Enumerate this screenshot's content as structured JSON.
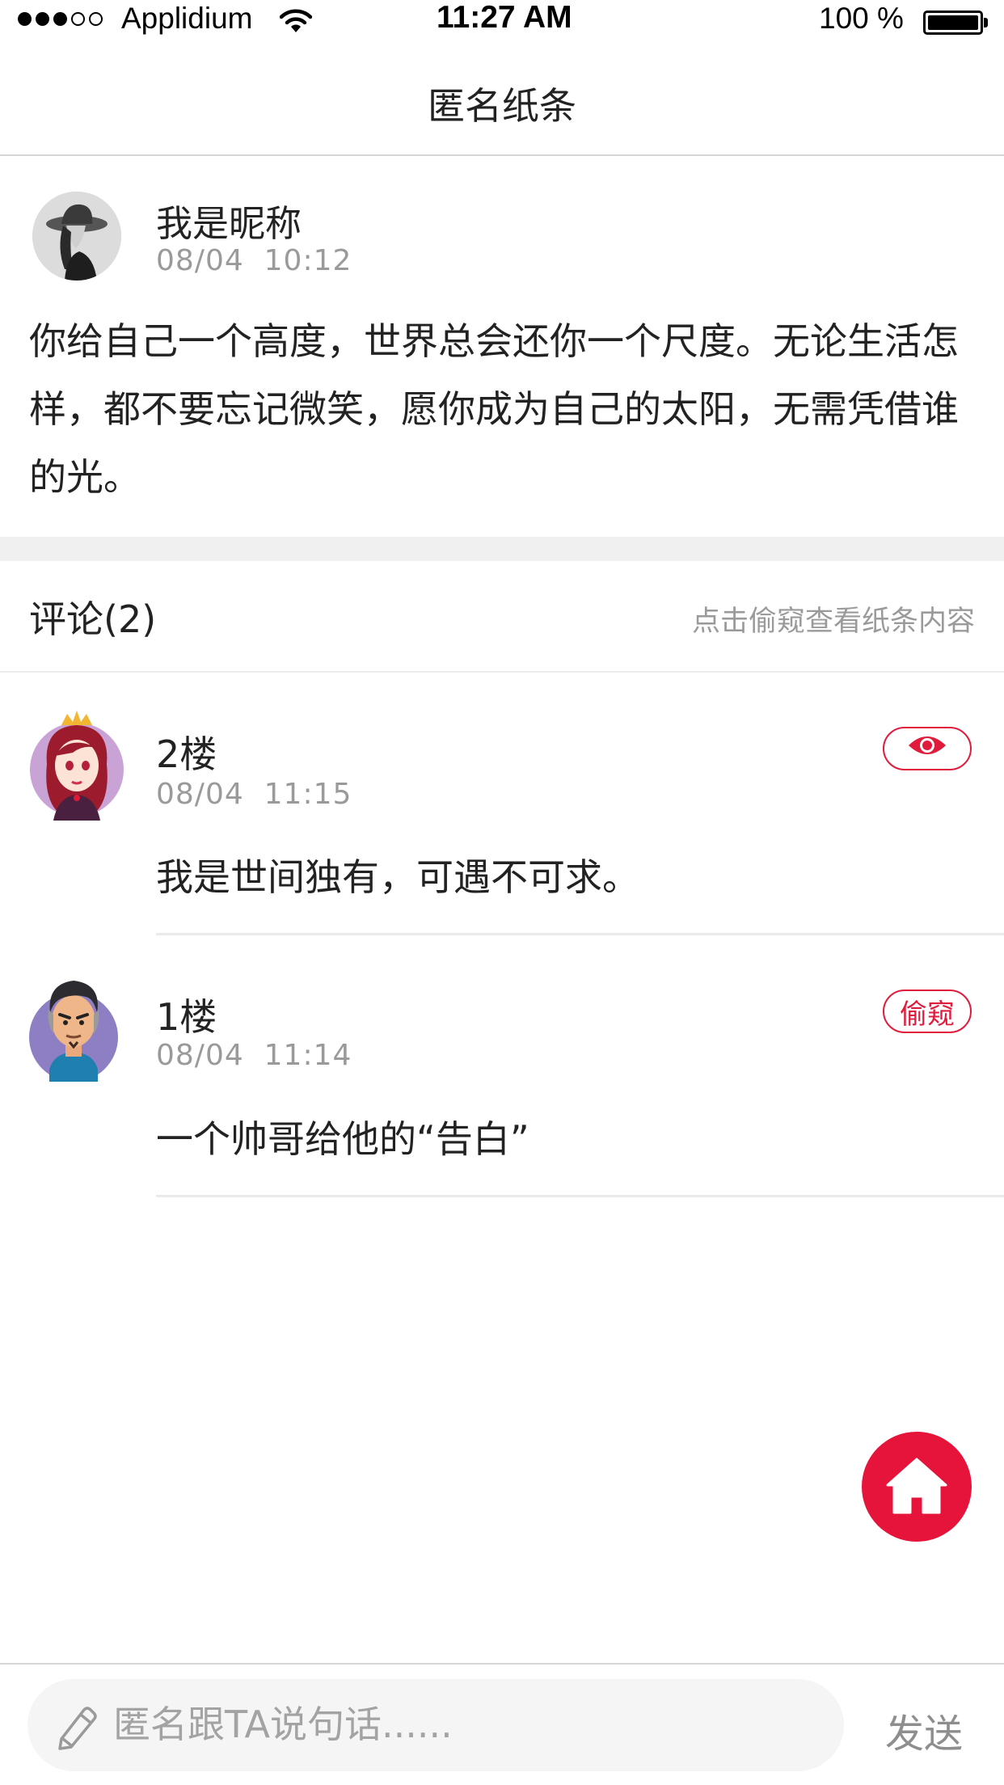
{
  "status_bar": {
    "carrier": "Applidium",
    "time": "11:27 AM",
    "battery": "100 %",
    "signal_bars_filled": 3,
    "signal_bars_total": 5
  },
  "nav": {
    "title": "匿名纸条"
  },
  "post": {
    "nickname": "我是昵称",
    "time": "08/04  10:12",
    "content": "你给自己一个高度，世界总会还你一个尺度。无论生活怎样，都不要忘记微笑，愿你成为自己的太阳，无需凭借谁的光。"
  },
  "comments_header": {
    "title": "评论(2)",
    "hint": "点击偷窥查看纸条内容"
  },
  "comments": [
    {
      "floor": "2楼",
      "time": "08/04  11:15",
      "content": "我是世间独有，可遇不可求。",
      "action_icon": "eye-icon"
    },
    {
      "floor": "1楼",
      "time": "08/04  11:14",
      "content": "一个帅哥给他的“告白”",
      "action_label": "偷窥"
    }
  ],
  "fab": {
    "icon": "home-icon"
  },
  "input_bar": {
    "placeholder": "匿名跟TA说句话......",
    "send_label": "发送",
    "icon": "pencil-icon"
  },
  "colors": {
    "accent": "#e6143a",
    "divider": "#d6d6d6",
    "muted_text": "#9a9a9a",
    "section_gap": "#f0f0f0"
  }
}
